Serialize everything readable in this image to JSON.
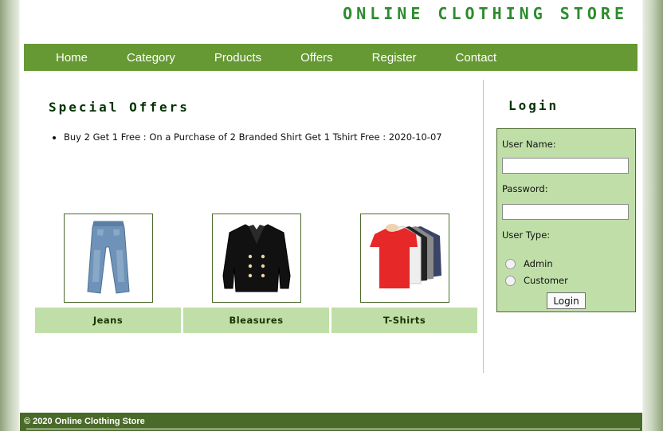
{
  "site": {
    "title": "ONLINE CLOTHING STORE"
  },
  "nav": {
    "items": [
      {
        "label": "Home"
      },
      {
        "label": "Category"
      },
      {
        "label": "Products"
      },
      {
        "label": "Offers"
      },
      {
        "label": "Register"
      },
      {
        "label": "Contact"
      }
    ]
  },
  "offers": {
    "heading": "Special Offers",
    "items": [
      {
        "text": "Buy 2 Get 1 Free : On a Purchase of 2 Branded Shirt Get 1 Tshirt Free : 2020-10-07"
      }
    ]
  },
  "products": [
    {
      "name": "Jeans",
      "icon": "jeans-image"
    },
    {
      "name": "Bleasures",
      "icon": "blazer-image"
    },
    {
      "name": "T-Shirts",
      "icon": "tshirts-image"
    }
  ],
  "login": {
    "heading": "Login",
    "username_label": "User Name:",
    "username_value": "",
    "password_label": "Password:",
    "password_value": "",
    "usertype_label": "User Type:",
    "options": [
      {
        "label": "Admin"
      },
      {
        "label": "Customer"
      }
    ],
    "button_label": "Login"
  },
  "footer": {
    "text": "© 2020 Online Clothing Store"
  },
  "colors": {
    "nav_bg": "#669933",
    "title_green": "#2e8b2e",
    "panel_bg": "#c0dfa8",
    "footer_bg": "#4a6a2a"
  }
}
